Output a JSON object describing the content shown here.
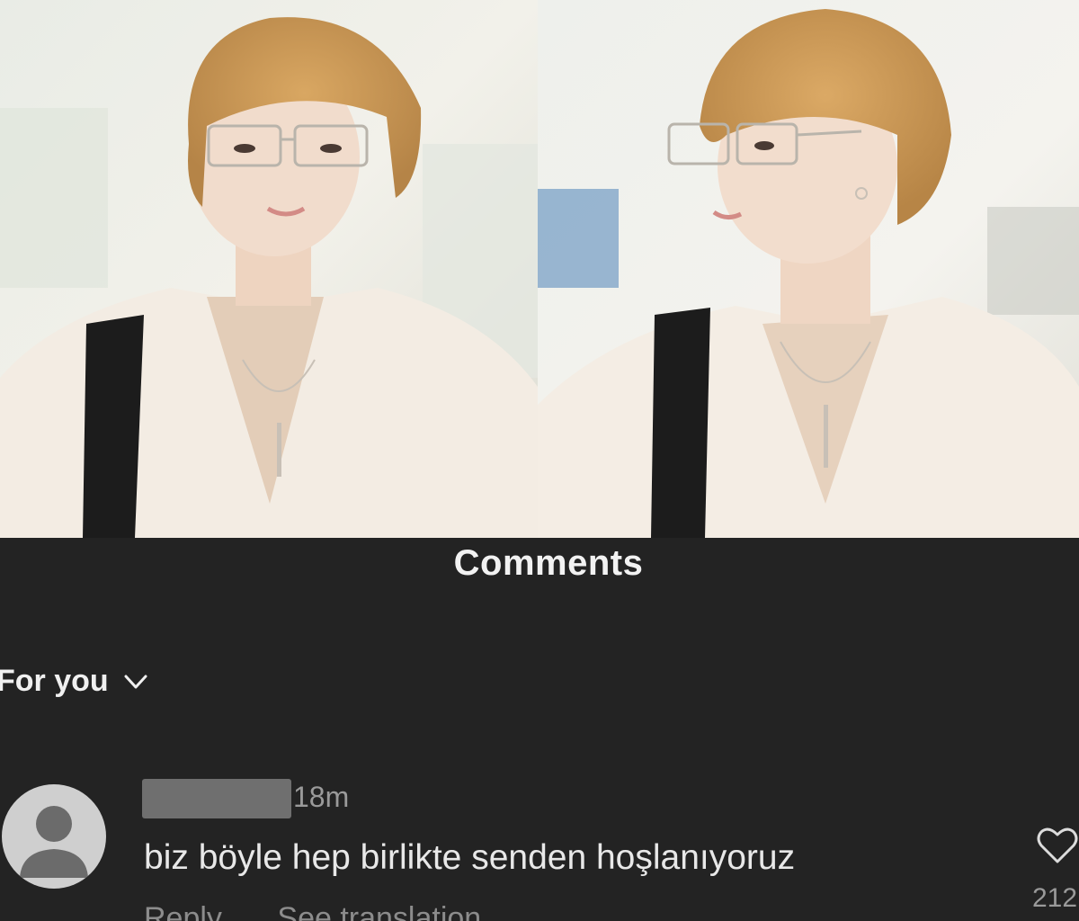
{
  "header": {
    "title": "Comments"
  },
  "sort": {
    "label": "For you",
    "icon": "chevron-down-icon"
  },
  "comments": [
    {
      "time": "18m",
      "text": "biz böyle hep birlikte senden hoşlanıyoruz",
      "reply_label": "Reply",
      "translate_label": "See translation",
      "like_count": "212",
      "like_icon": "heart-icon",
      "avatar_icon": "default-avatar-icon"
    }
  ],
  "colors": {
    "background": "#232323",
    "text_primary": "#f2f2f2",
    "text_secondary": "#9a9a9a"
  }
}
